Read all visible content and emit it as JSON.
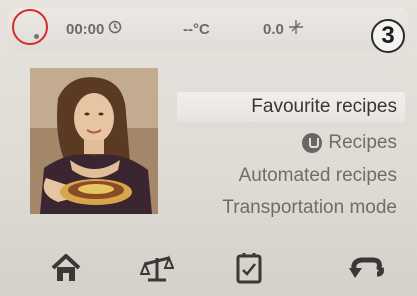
{
  "status_bar": {
    "time": "00:00",
    "time_icon": "clock-icon",
    "temperature": "--°C",
    "speed": "0.0",
    "speed_icon": "fan-icon"
  },
  "callout_number": "3",
  "menu": {
    "items": [
      {
        "label": "Favourite recipes",
        "selected": true
      },
      {
        "label": "Recipes",
        "icon": "recipe-icon"
      },
      {
        "label": "Automated recipes"
      },
      {
        "label": "Transportation mode"
      }
    ]
  },
  "bottom_bar": {
    "buttons": [
      {
        "icon": "home-icon"
      },
      {
        "icon": "scale-icon"
      },
      {
        "icon": "timer-icon"
      },
      {
        "icon": "reverse-icon"
      }
    ]
  },
  "colors": {
    "accent_callout": "#d52b2b",
    "text": "#716c68",
    "selected_text": "#3a3634"
  }
}
